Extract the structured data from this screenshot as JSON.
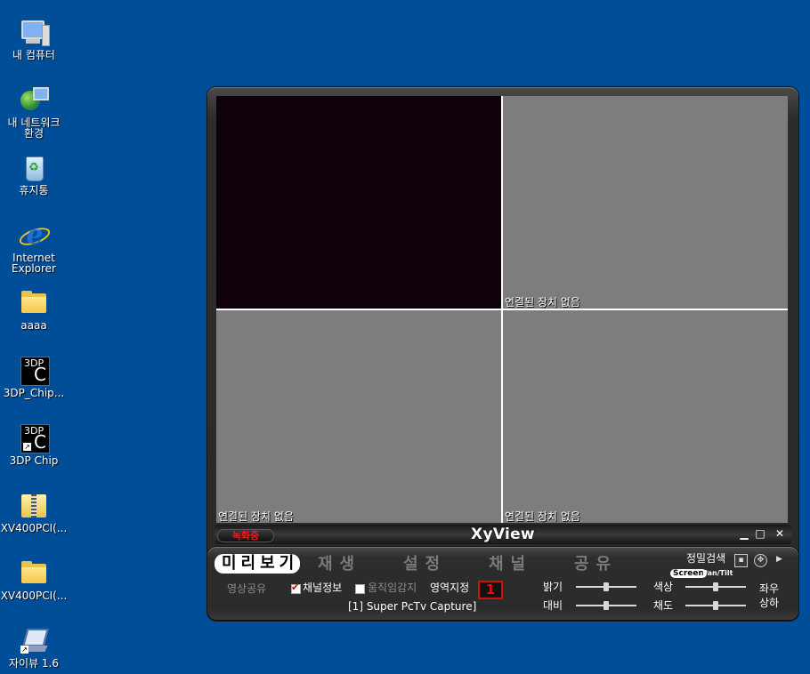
{
  "desktop": {
    "icons": [
      {
        "label": "내 컴퓨터",
        "icon": "my-computer-icon"
      },
      {
        "label": "내 네트워크\n환경",
        "icon": "network-places-icon"
      },
      {
        "label": "휴지통",
        "icon": "recycle-bin-icon"
      },
      {
        "label": "Internet\nExplorer",
        "icon": "internet-explorer-icon"
      },
      {
        "label": "aaaa",
        "icon": "folder-icon"
      },
      {
        "label": "3DP_Chip...",
        "icon": "3dp-chip-icon"
      },
      {
        "label": "3DP Chip",
        "icon": "3dp-chip-shortcut-icon"
      },
      {
        "label": "XV400PCI(...",
        "icon": "zip-folder-icon"
      },
      {
        "label": "XV400PCI(...",
        "icon": "folder-icon"
      },
      {
        "label": "자이뷰 1.6",
        "icon": "xyview-shortcut-icon"
      }
    ]
  },
  "app": {
    "title": "XyView",
    "recording_badge": "녹화중",
    "window_buttons": {
      "minimize": "▁",
      "maximize": "□",
      "close": "✕"
    }
  },
  "video": {
    "cells": [
      {
        "label": ""
      },
      {
        "label": "연결된 장치 없음"
      },
      {
        "label": "연결된 장치 없음"
      },
      {
        "label": "연결된 장치 없음"
      }
    ]
  },
  "controls": {
    "tabs": [
      "미리보기",
      "재생",
      "설정",
      "채널",
      "공유"
    ],
    "active_tab": 0,
    "share_video": "영상공유",
    "channel_info": "채널정보",
    "channel_info_checked": true,
    "motion_detect": "움직임감지",
    "motion_detect_checked": false,
    "region_label": "영역지정",
    "region_number": "1",
    "device_name": "[1] Super PcTv Capture]",
    "precise_search": "정밀검색",
    "screen_label": "Screen",
    "pan_tilt_label": "Pan/Tilt",
    "brightness": "밝기",
    "contrast": "대비",
    "hue": "색상",
    "saturation": "채도",
    "left_right": "좌우",
    "up_down": "상하",
    "slider_values": {
      "brightness": 0.5,
      "contrast": 0.5,
      "hue": 0.5,
      "saturation": 0.5
    }
  }
}
